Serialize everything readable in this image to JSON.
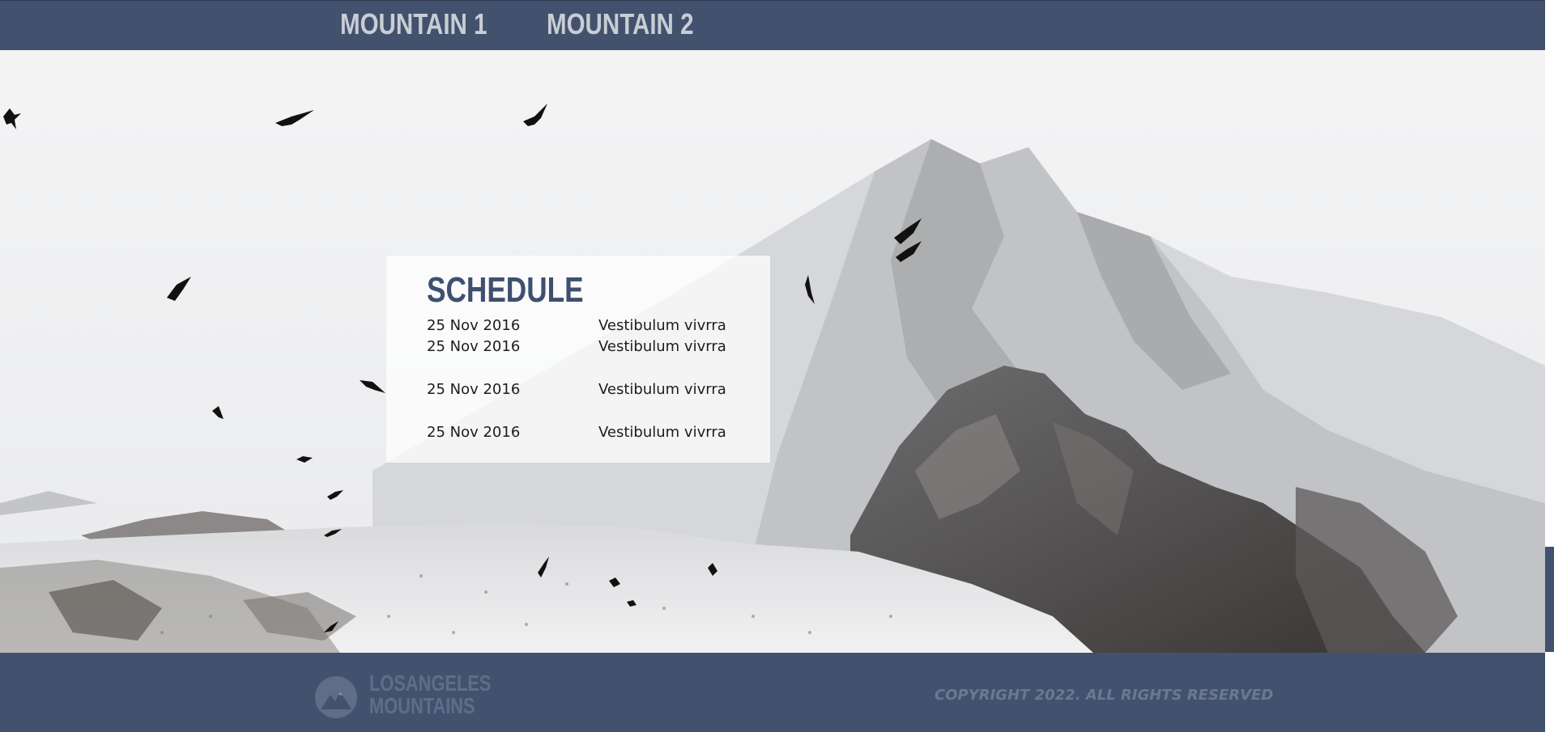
{
  "nav": {
    "items": [
      {
        "label": "MOUNTAIN 1"
      },
      {
        "label": "MOUNTAIN 2"
      }
    ]
  },
  "schedule": {
    "title": "SCHEDULE",
    "rows": [
      {
        "date": "25 Nov 2016",
        "text": "Vestibulum vivrra"
      },
      {
        "date": "25 Nov 2016",
        "text": "Vestibulum vivrra"
      },
      {
        "date": "25 Nov 2016",
        "text": "Vestibulum vivrra"
      },
      {
        "date": "25 Nov 2016",
        "text": "Vestibulum vivrra"
      }
    ]
  },
  "footer": {
    "logo_line1": "LOSANGELES",
    "logo_line2": "MOUNTAINS",
    "copyright": "COPYRIGHT 2022. ALL RIGHTS RESERVED"
  },
  "colors": {
    "brand": "#42526e",
    "nav_text": "#c9cdd4",
    "title": "#3f4f6e"
  },
  "icons": {
    "logo": "mountain-logo-icon"
  }
}
